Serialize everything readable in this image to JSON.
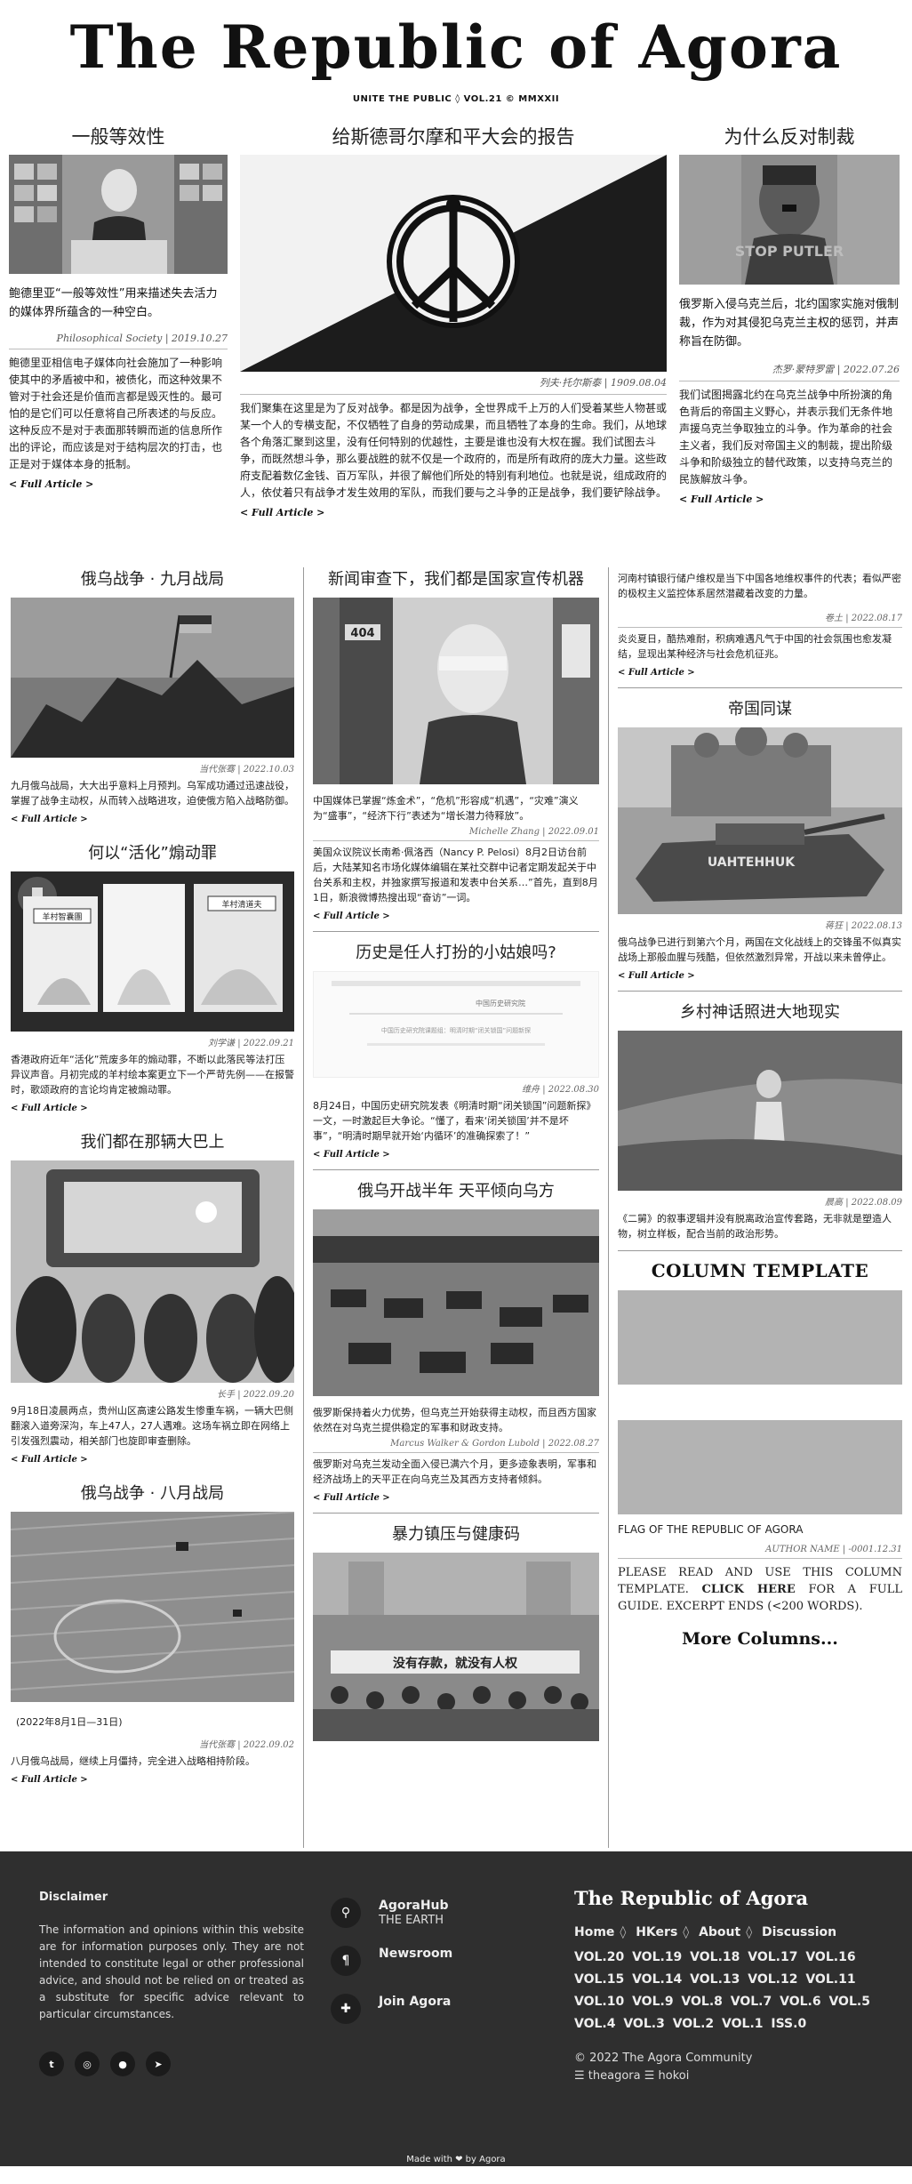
{
  "masthead": {
    "title": "The Republic of Agora",
    "edition": "UNITE THE PUBLIC ◊ VOL.21 © MMXXII"
  },
  "top": {
    "left": {
      "title": "一般等效性",
      "lede": "鲍德里亚“一般等效性”用来描述失去活力的媒体界所蕴含的一种空白。",
      "byline": "Philosophical Society | 2019.10.27",
      "body": "鲍德里亚相信电子媒体向社会施加了一种影响使其中的矛盾被中和，被债化，而这种效果不管对于社会还是价值而言都是毁灭性的。最可怕的是它们可以任意将自己所表述的与反应。这种反应不是对于表面那转瞬而逝的信息所作出的评论，而应该是对于结构层次的打击，也正是对于媒体本身的抵制。",
      "full": "< Full Article >"
    },
    "center": {
      "title": "给斯德哥尔摩和平大会的报告",
      "byline": "列夫·托尔斯泰 | 1909.08.04",
      "body": "我们聚集在这里是为了反对战争。都是因为战争，全世界成千上万的人们受着某些人物甚或某一个人的专横支配，不仅牺牲了自身的劳动成果，而且牺牲了本身的生命。我们，从地球各个角落汇聚到这里，没有任何特别的优越性，主要是谁也没有大权在握。我们试图去斗争，而既然想斗争，那么要战胜的就不仅是一个政府的，而是所有政府的庞大力量。这些政府支配着数亿金钱、百万军队，并很了解他们所处的特别有利地位。也就是说，组成政府的人，依仗着只有战争才发生效用的军队，而我们要与之斗争的正是战争，我们要铲除战争。",
      "full": "< Full Article >"
    },
    "right": {
      "title": "为什么反对制裁",
      "lede": "俄罗斯入侵乌克兰后，北约国家实施对俄制裁，作为对其侵犯乌克兰主权的惩罚，并声称旨在防御。",
      "byline": "杰罗·蒙特罗雷 | 2022.07.26",
      "body": "我们试图揭露北约在乌克兰战争中所扮演的角色背后的帝国主义野心，并表示我们无条件地声援乌克兰争取独立的斗争。作为革命的社会主义者，我们反对帝国主义的制裁，提出阶级斗争和阶级独立的替代政策，以支持乌克兰的民族解放斗争。",
      "full": "< Full Article >"
    },
    "img_labels": {
      "stop": "STOP PUTLER",
      "tank": "UAHTEHHUK"
    }
  },
  "grid": {
    "col1": [
      {
        "title": "俄乌战争 · 九月战局",
        "byline": "当代张骞 | 2022.10.03",
        "body": "九月俄乌战局，大大出乎意料上月预判。乌军成功通过迅速战役，掌握了战争主动权，从而转入战略进攻，迫使俄方陷入战略防御。",
        "full": "< Full Article >"
      },
      {
        "title": "何以“活化”煽动罪",
        "byline": "刘学谦 | 2022.09.21",
        "body": "香港政府近年“活化”荒废多年的煽动罪，不断以此落民等法打压异议声音。月初完成的羊村绘本案更立下一个严苛先例——在报警时，歌颂政府的言论均肯定被煽动罪。",
        "full": "< Full Article >",
        "panels": [
          "羊村智囊團",
          "羊村清道夫"
        ]
      },
      {
        "title": "我们都在那辆大巴上",
        "byline": "长手 | 2022.09.20",
        "body": "9月18日凌晨两点，贵州山区高速公路发生惨重车祸，一辆大巴侧翻滚入道旁深沟，车上47人，27人遇难。这场车祸立即在网络上引发强烈震动，相关部门也旋即审查删除。",
        "full": "< Full Article >"
      },
      {
        "title": "俄乌战争 · 八月战局",
        "caption": "(2022年8月1日—31日)",
        "byline": "当代张骞 | 2022.09.02",
        "body": "八月俄乌战局，继续上月僵持，完全进入战略相持阶段。",
        "full": "< Full Article >"
      }
    ],
    "col2": [
      {
        "title": "新闻审查下，我们都是国家宣传机器",
        "byline": "Michelle Zhang | 2022.09.01",
        "body": "中国媒体已掌握“炼金术”，“危机”形容成“机遇”，“灾难”演义为“盛事”，“经济下行”表述为“增长潜力待释放”。",
        "body2": "美国众议院议长南希·佩洛西（Nancy P. Pelosi）8月2日访台前后，大陆某知名市场化媒体编辑在某社交群中记者定期发起关于中台关系和主权，并独家撰写报道和发表中台关系…”首先，直到8月1日，新浪微博热搜出现“奋访”一词。",
        "full": "< Full Article >",
        "door": "404"
      },
      {
        "title": "历史是任人打扮的小姑娘吗?",
        "byline": "维舟 | 2022.08.30",
        "body": "8月24日，中国历史研究院发表《明清时期“闭关锁国”问题新探》一文，一时激起巨大争论。“懂了，看来‘闭关锁国’并不是坏事”，“明清时期早就开始‘内循环’的准确探索了！”",
        "full": "< Full Article >",
        "shot_title": "中国历史研究院",
        "shot_line": "中国历史研究院课题组：明清时期“闭关锁国”问题新探"
      },
      {
        "title": "俄乌开战半年 天平倾向乌方",
        "byline": "Marcus Walker & Gordon Lubold | 2022.08.27",
        "body": "俄罗斯保持着火力优势，但乌克兰开始获得主动权，而且西方国家依然在对乌克兰提供稳定的军事和财政支持。",
        "body2": "俄罗斯对乌克兰发动全面入侵已满六个月，更多迹象表明，军事和经济战场上的天平正在向乌克兰及其西方支持者倾斜。",
        "full": "< Full Article >"
      },
      {
        "title": "暴力镇压与健康码",
        "banner": "没有存款，就没有人权"
      }
    ],
    "col3": [
      {
        "body": "河南村镇银行储户维权是当下中国各地维权事件的代表；看似严密的极权主义监控体系居然潜藏着改变的力量。",
        "byline": "卷土 | 2022.08.17",
        "body2": "炎炎夏日，酷热难耐，积病难遇凡气于中国的社会氛围也愈发凝结，显现出某种经济与社会危机征兆。",
        "full": "< Full Article >"
      },
      {
        "title": "帝国同谋",
        "byline": "蒋狂 | 2022.08.13",
        "body": "俄乌战争已进行到第六个月，两国在文化战线上的交锋虽不似真实战场上那般血腥与残酷，但依然激烈异常，开战以来未曾停止。",
        "full": "< Full Article >"
      },
      {
        "title": "乡村神话照进大地现实",
        "byline": "晨高 | 2022.08.09",
        "body": "《二舅》的叙事逻辑并没有脱离政治宣传套路，无非就是塑造人物，树立样板，配合当前的政治形势。",
        "full": "< Full Article >"
      }
    ],
    "template": {
      "title": "COLUMN TEMPLATE",
      "flag": "FLAG OF THE REPUBLIC OF AGORA",
      "byline": "AUTHOR NAME | -0001.12.31",
      "text1": "PLEASE READ AND USE THIS COLUMN TEMPLATE.",
      "link": "CLICK HERE",
      "text2": "FOR A FULL GUIDE. EXCERPT ENDS (<200 WORDS).",
      "more": "More Columns..."
    }
  },
  "footer": {
    "disclaimer_title": "Disclaimer",
    "disclaimer": "The information and opinions within this website are for information purposes only. They are not intended to constitute legal or other professional advice, and should not be relied on or treated as a substitute for specific advice relevant to particular circumstances.",
    "links": [
      {
        "title": "AgoraHub",
        "sub": "THE EARTH",
        "icon": "location-icon"
      },
      {
        "title": "Newsroom",
        "sub": "",
        "icon": "paragraph-icon"
      },
      {
        "title": "Join Agora",
        "sub": "",
        "icon": "puzzle-icon"
      }
    ],
    "logo": "The Republic of Agora",
    "nav": [
      "Home",
      "HKers",
      "About",
      "Discussion"
    ],
    "vols": "VOL.20 VOL.19 VOL.18 VOL.17 VOL.16 VOL.15 VOL.14 VOL.13 VOL.12 VOL.11 VOL.10 VOL.9 VOL.8 VOL.7 VOL.6 VOL.5 VOL.4 VOL.3 VOL.2 VOL.1 ISS.0",
    "copyright": "© 2022 The Agora Community",
    "handles": "☰ theagora ☰ hokoi",
    "made_with": "Made with ❤ by Agora"
  }
}
